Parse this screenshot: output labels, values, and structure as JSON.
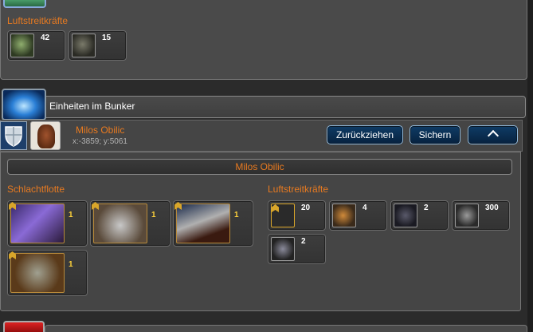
{
  "top_section": {
    "title": "Luftstreitkräfte",
    "units": [
      {
        "icon": "bio-walker-icon",
        "count": "42"
      },
      {
        "icon": "mech-trooper-icon",
        "count": "15"
      }
    ]
  },
  "bunker": {
    "title": "Einheiten im Bunker",
    "player": {
      "name": "Milos Obilic",
      "coords": "x:-3859; y:5061"
    },
    "buttons": {
      "withdraw": "Zurückziehen",
      "secure": "Sichern"
    },
    "banner": "Milos Obilic",
    "battle_fleet": {
      "title": "Schlachtflotte",
      "units": [
        {
          "icon": "cruiser-ship-icon",
          "count": "1"
        },
        {
          "icon": "gun-walker-icon",
          "count": "1"
        },
        {
          "icon": "capital-ship-icon",
          "count": "1"
        },
        {
          "icon": "heavy-mech-icon",
          "count": "1"
        }
      ]
    },
    "air_force": {
      "title": "Luftstreitkräfte",
      "units": [
        {
          "icon": "empty-slot-icon",
          "count": "20"
        },
        {
          "icon": "orange-mech-icon",
          "count": "4"
        },
        {
          "icon": "spider-drone-icon",
          "count": "2"
        },
        {
          "icon": "gunship-icon",
          "count": "300"
        },
        {
          "icon": "fighter-mech-icon",
          "count": "2"
        }
      ]
    }
  },
  "colors": {
    "accent": "#e87a20",
    "button_bg": "#0f3c66",
    "rank_gold": "#d9a62a",
    "count_yellow": "#ffd23a"
  }
}
